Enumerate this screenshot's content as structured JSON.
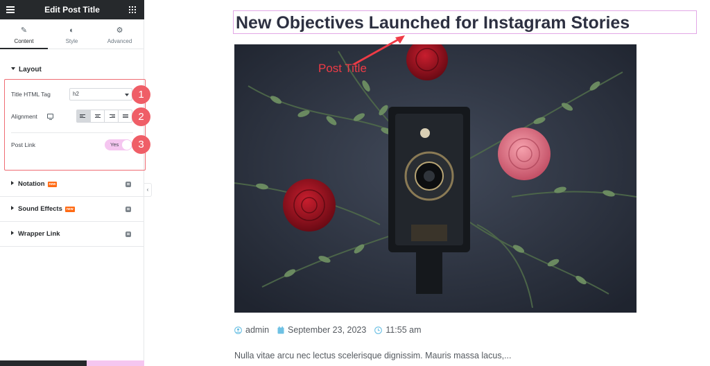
{
  "panel": {
    "title": "Edit Post Title",
    "tabs": [
      {
        "label": "Content",
        "icon": "pencil-icon",
        "active": true
      },
      {
        "label": "Style",
        "icon": "half-circle-icon",
        "active": false
      },
      {
        "label": "Advanced",
        "icon": "gear-icon",
        "active": false
      }
    ],
    "layout_section": {
      "title": "Layout",
      "title_html_tag": {
        "label": "Title HTML Tag",
        "value": "h2"
      },
      "alignment": {
        "label": "Alignment",
        "options": [
          "left",
          "center",
          "right",
          "justify"
        ],
        "selected": "left"
      },
      "post_link": {
        "label": "Post Link",
        "value": "Yes"
      }
    },
    "markers": [
      "1",
      "2",
      "3"
    ],
    "accordion": [
      {
        "title": "Notation",
        "badge": "new"
      },
      {
        "title": "Sound Effects",
        "badge": "new"
      },
      {
        "title": "Wrapper Link",
        "badge": ""
      }
    ]
  },
  "preview": {
    "post_title": "New Objectives Launched for Instagram Stories",
    "annotation": "Post Title",
    "meta": {
      "author": "admin",
      "date": "September 23, 2023",
      "time": "11:55 am"
    },
    "excerpt": "Nulla vitae arcu nec lectus scelerisque dignissim. Mauris massa lacus,..."
  },
  "colors": {
    "annotation": "#ef3b46",
    "marker": "#ef5e67",
    "toggle_on": "#f5c6f0",
    "header_dark": "#26292c",
    "title_outline": "#e2a6e6",
    "meta_icon": "#6ec1e4"
  }
}
